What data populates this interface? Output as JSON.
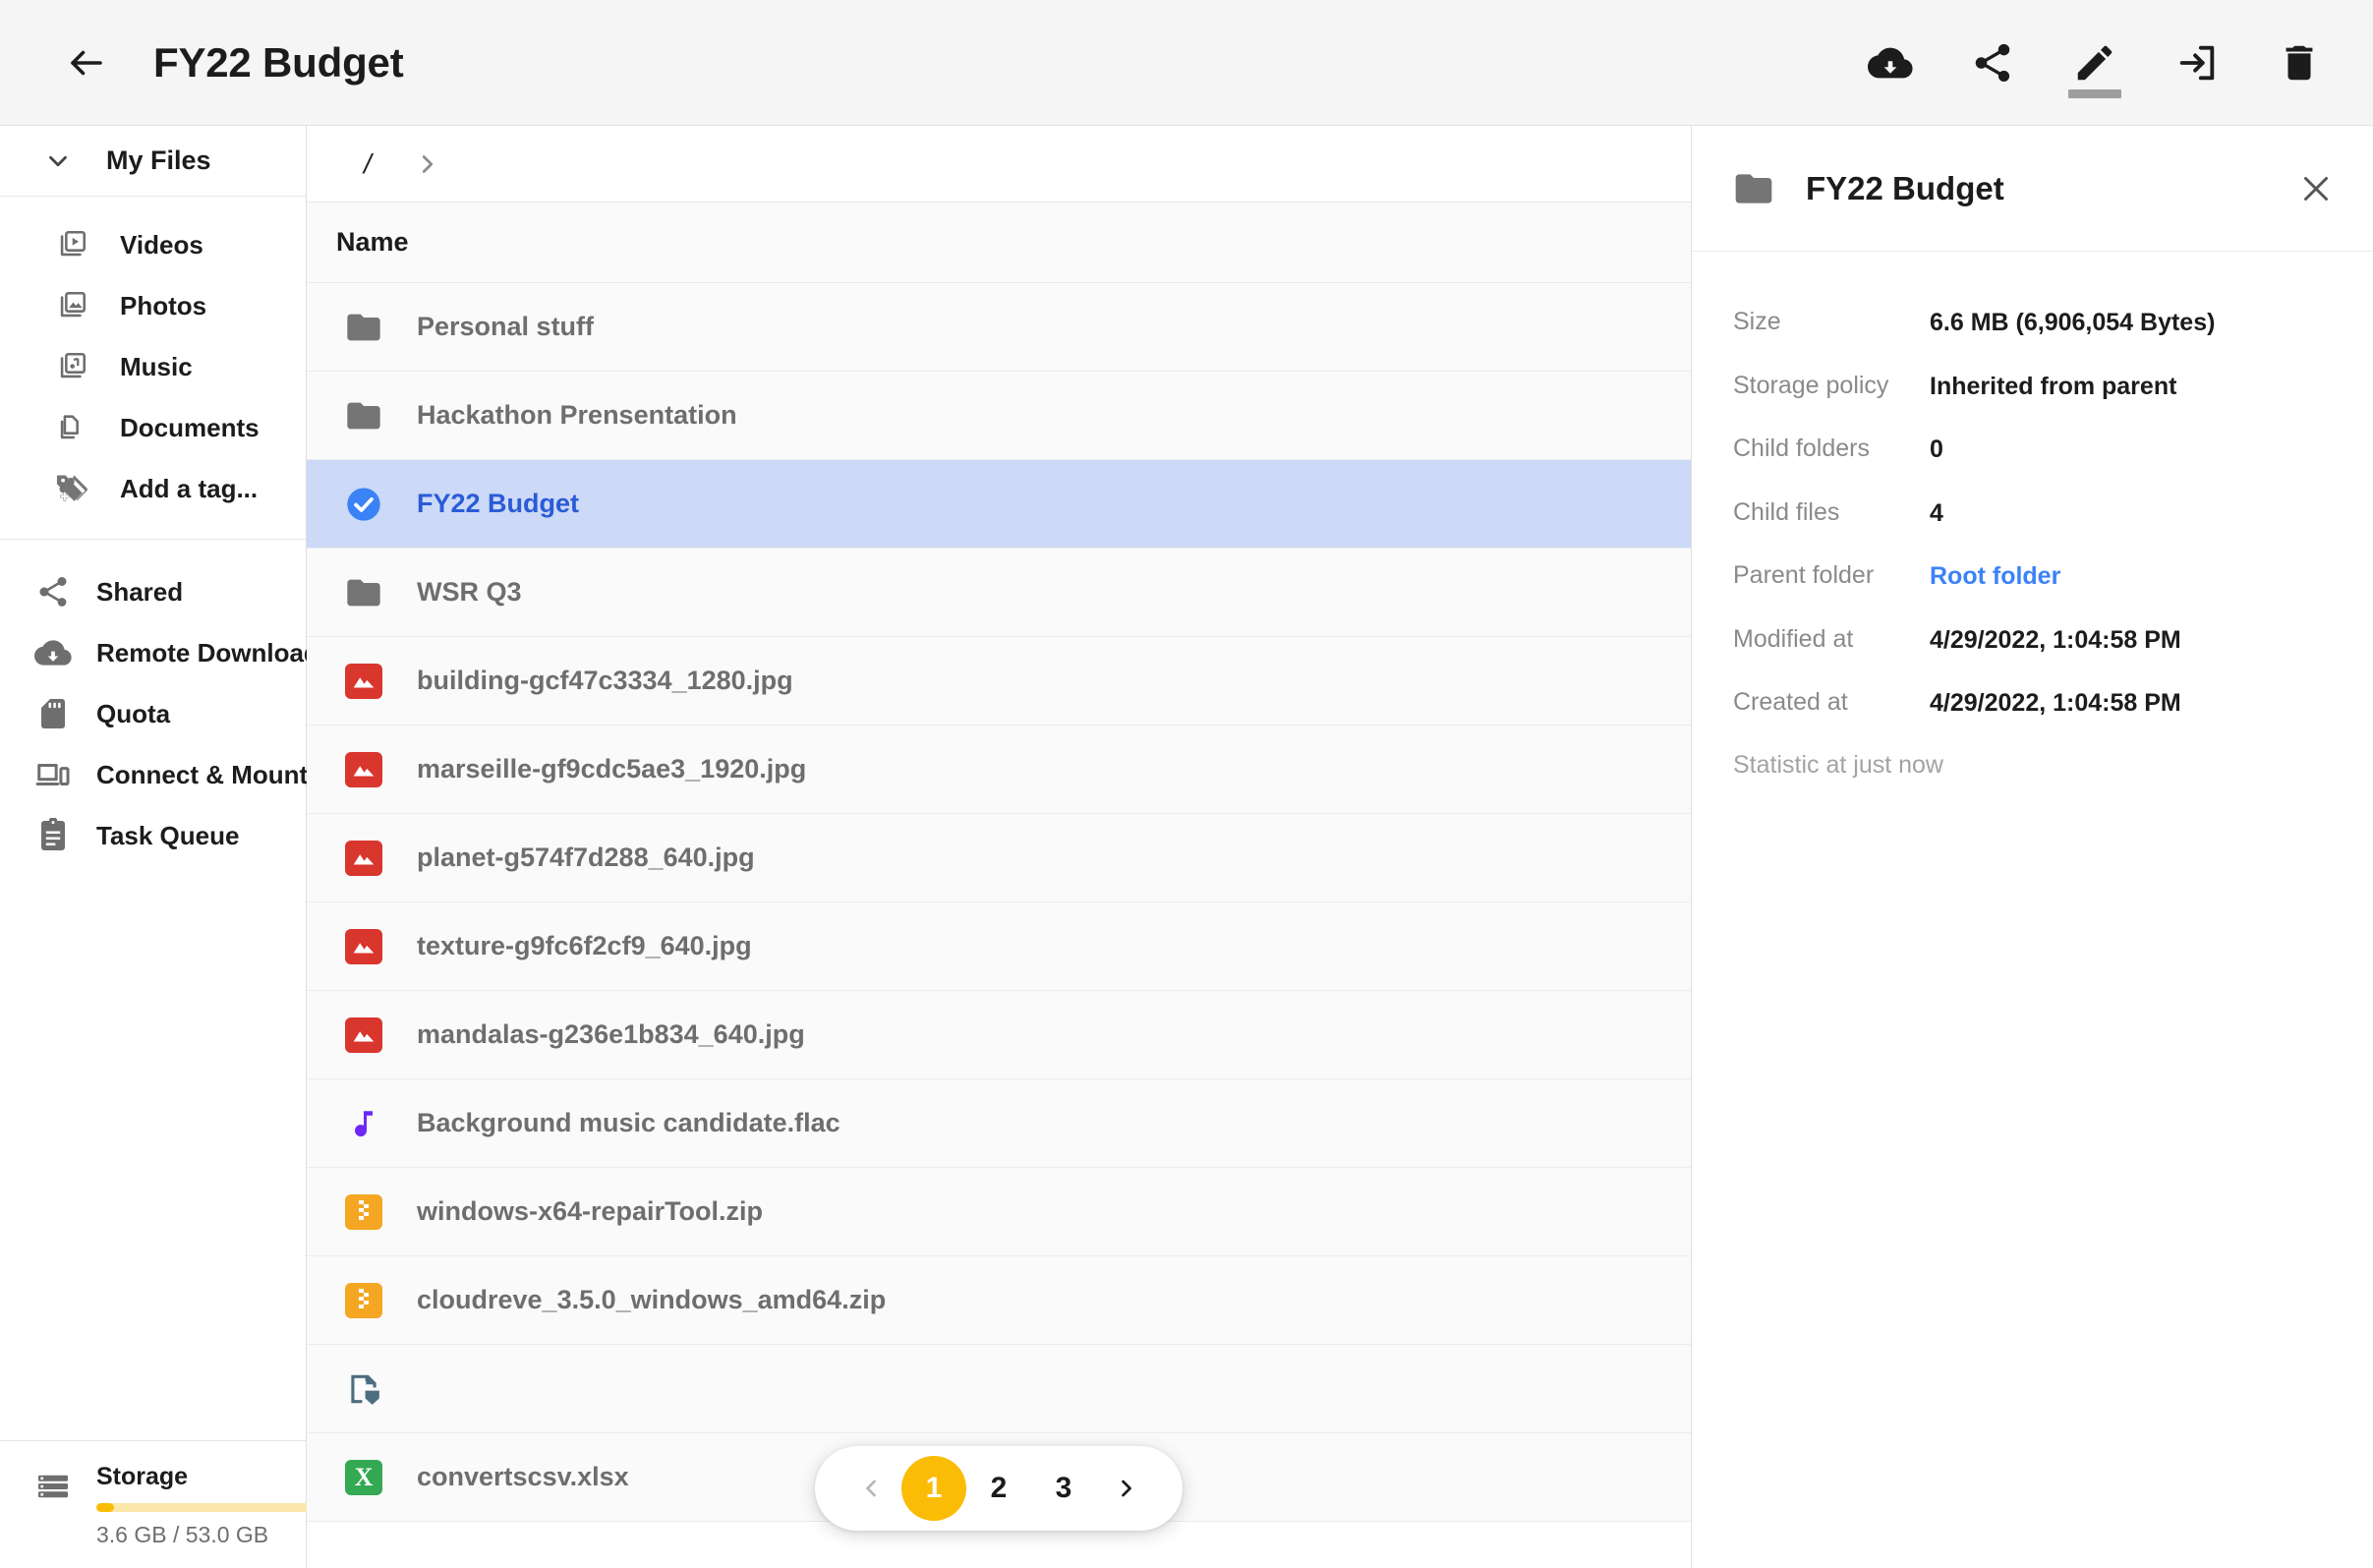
{
  "header": {
    "back_icon": "arrow-left-icon",
    "title": "FY22 Budget",
    "actions": [
      {
        "name": "download-button",
        "icon": "cloud-download-icon",
        "label": "Download"
      },
      {
        "name": "share-button",
        "icon": "share-icon",
        "label": "Share"
      },
      {
        "name": "rename-button",
        "icon": "edit-pencil-icon",
        "label": "Rename"
      },
      {
        "name": "move-button",
        "icon": "move-into-icon",
        "label": "Move"
      },
      {
        "name": "delete-button",
        "icon": "trash-icon",
        "label": "Delete"
      }
    ]
  },
  "sidebar": {
    "my_files_label": "My Files",
    "my_files_chevron": "chevron-down-icon",
    "categories": [
      {
        "label": "Videos",
        "icon": "video-library-icon"
      },
      {
        "label": "Photos",
        "icon": "photo-library-icon"
      },
      {
        "label": "Music",
        "icon": "music-library-icon"
      },
      {
        "label": "Documents",
        "icon": "documents-icon"
      },
      {
        "label": "Add a tag...",
        "icon": "tag-plus-icon"
      }
    ],
    "nav": [
      {
        "label": "Shared",
        "icon": "share-icon"
      },
      {
        "label": "Remote Download",
        "icon": "cloud-download-icon"
      },
      {
        "label": "Quota",
        "icon": "sd-card-icon"
      },
      {
        "label": "Connect & Mount",
        "icon": "devices-icon"
      },
      {
        "label": "Task Queue",
        "icon": "clipboard-list-icon"
      }
    ],
    "storage": {
      "icon": "storage-icon",
      "title": "Storage",
      "used_label": "3.6 GB / 53.0 GB",
      "percent": 6.8,
      "bar_color": "#fbbc05",
      "track_color": "#fde8ab"
    }
  },
  "breadcrumb": {
    "root": "/",
    "separator_icon": "chevron-right-icon"
  },
  "file_table": {
    "columns": [
      "Name"
    ],
    "rows": [
      {
        "name": "Personal stuff",
        "icon": "folder-icon",
        "type": "folder",
        "selected": false
      },
      {
        "name": "Hackathon Prensentation",
        "icon": "folder-icon",
        "type": "folder",
        "selected": false
      },
      {
        "name": "FY22 Budget",
        "icon": "check-circle-icon",
        "type": "folder",
        "selected": true
      },
      {
        "name": "WSR Q3",
        "icon": "folder-icon",
        "type": "folder",
        "selected": false
      },
      {
        "name": "building-gcf47c3334_1280.jpg",
        "icon": "image-file-icon",
        "type": "image",
        "selected": false
      },
      {
        "name": "marseille-gf9cdc5ae3_1920.jpg",
        "icon": "image-file-icon",
        "type": "image",
        "selected": false
      },
      {
        "name": "planet-g574f7d288_640.jpg",
        "icon": "image-file-icon",
        "type": "image",
        "selected": false
      },
      {
        "name": "texture-g9fc6f2cf9_640.jpg",
        "icon": "image-file-icon",
        "type": "image",
        "selected": false
      },
      {
        "name": "mandalas-g236e1b834_640.jpg",
        "icon": "image-file-icon",
        "type": "image",
        "selected": false
      },
      {
        "name": "Background music candidate.flac",
        "icon": "music-note-icon",
        "type": "audio",
        "selected": false
      },
      {
        "name": "windows-x64-repairTool.zip",
        "icon": "zip-file-icon",
        "type": "archive",
        "selected": false
      },
      {
        "name": "cloudreve_3.5.0_windows_amd64.zip",
        "icon": "zip-file-icon",
        "type": "archive",
        "selected": false
      },
      {
        "name": "",
        "icon": "code-file-icon",
        "type": "code",
        "selected": false
      },
      {
        "name": "convertscsv.xlsx",
        "icon": "excel-file-icon",
        "type": "spreadsheet",
        "selected": false
      }
    ]
  },
  "pagination": {
    "prev_icon": "chevron-left-icon",
    "next_icon": "chevron-right-icon",
    "pages": [
      "1",
      "2",
      "3"
    ],
    "current": "1"
  },
  "detail_panel": {
    "icon": "folder-icon",
    "title": "FY22 Budget",
    "close_icon": "close-icon",
    "fields": [
      {
        "key": "Size",
        "value": "6.6 MB (6,906,054 Bytes)",
        "link": false
      },
      {
        "key": "Storage policy",
        "value": "Inherited from parent",
        "link": false
      },
      {
        "key": "Child folders",
        "value": "0",
        "link": false
      },
      {
        "key": "Child files",
        "value": "4",
        "link": false
      },
      {
        "key": "Parent folder",
        "value": "Root folder",
        "link": true
      },
      {
        "key": "Modified at",
        "value": "4/29/2022, 1:04:58 PM",
        "link": false
      },
      {
        "key": "Created at",
        "value": "4/29/2022, 1:04:58 PM",
        "link": false
      }
    ],
    "statistic": "Statistic at just now"
  },
  "colors": {
    "accent_blue": "#3b82f6",
    "selected_row_bg": "#ccd9f7",
    "amber": "#fbbc05",
    "image_icon": "#d9362d",
    "zip_icon": "#f5a623",
    "excel_icon": "#34a853",
    "music_icon": "#6d28f5",
    "code_icon": "#4d6d80",
    "folder_icon": "#757575"
  }
}
